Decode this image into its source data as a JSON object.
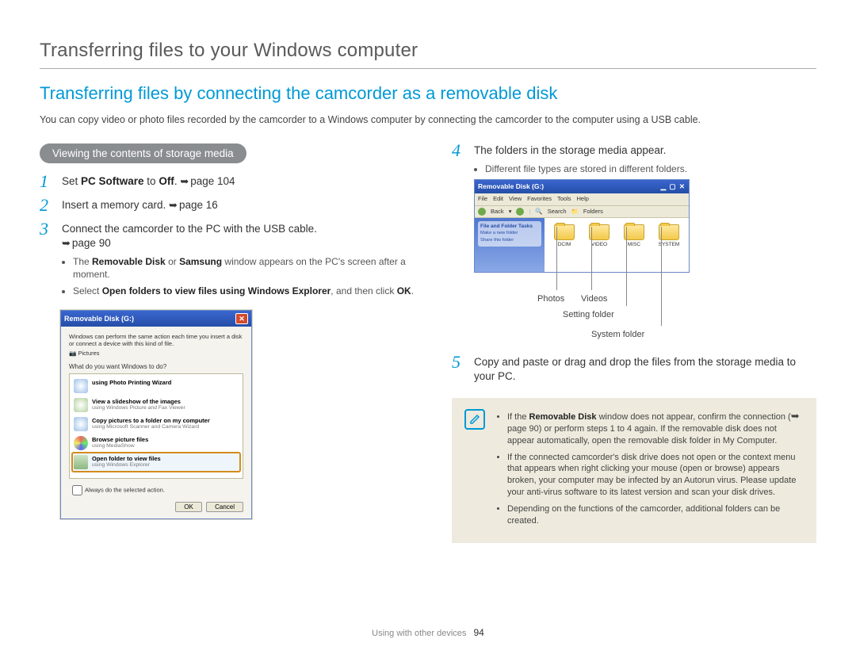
{
  "page_title": "Transferring files to your Windows computer",
  "section_heading": "Transferring files by connecting the camcorder as a removable disk",
  "intro": "You can copy video or photo files recorded by the camcorder to a Windows computer by connecting the camcorder to the computer using a USB cable.",
  "pill": "Viewing the contents of storage media",
  "arrow_glyph": "➥",
  "steps": {
    "s1": {
      "num": "1",
      "pre": "Set ",
      "bold": "PC Software",
      "mid": " to ",
      "bold2": "Off",
      "post": ". ",
      "page": "page 104"
    },
    "s2": {
      "num": "2",
      "text": "Insert a memory card. ",
      "page": "page 16"
    },
    "s3": {
      "num": "3",
      "text": "Connect the camcorder to the PC with the USB cable. ",
      "page": "page 90",
      "b1_pre": "The ",
      "b1_b1": "Removable Disk",
      "b1_mid": " or ",
      "b1_b2": "Samsung",
      "b1_post": " window appears on the PC's screen after a moment.",
      "b2_pre": "Select ",
      "b2_b": "Open folders to view files using Windows Explorer",
      "b2_mid": ", and then click ",
      "b2_b2": "OK",
      "b2_post": "."
    },
    "s4": {
      "num": "4",
      "text": "The folders in the storage media appear.",
      "b1": "Different file types are stored in different folders."
    },
    "s5": {
      "num": "5",
      "text": "Copy and paste or drag and drop the files from the storage media to your PC."
    }
  },
  "dialog": {
    "title": "Removable Disk (G:)",
    "hint": "Windows can perform the same action each time you insert a disk or connect a device with this kind of file.",
    "pictures": "Pictures",
    "question": "What do you want Windows to do?",
    "items": [
      {
        "b": "using Photo Printing Wizard",
        "s": ""
      },
      {
        "b": "View a slideshow of the images",
        "s": "using Windows Picture and Fax Viewer"
      },
      {
        "b": "Copy pictures to a folder on my computer",
        "s": "using Microsoft Scanner and Camera Wizard"
      },
      {
        "b": "Browse picture files",
        "s": "using MediaShow"
      },
      {
        "b": "Open folder to view files",
        "s": "using Windows Explorer"
      }
    ],
    "always": "Always do the selected action.",
    "ok": "OK",
    "cancel": "Cancel"
  },
  "explorer": {
    "title": "Removable Disk (G:)",
    "menu": [
      "File",
      "Edit",
      "View",
      "Favorites",
      "Tools",
      "Help"
    ],
    "toolbar": {
      "back": "Back",
      "search": "Search",
      "folders": "Folders"
    },
    "side": {
      "heading": "File and Folder Tasks",
      "i1": "Make a new folder",
      "i2": "Share this folder",
      "i3": ""
    },
    "folders": [
      "DCIM",
      "VIDEO",
      "MISC",
      "SYSTEM"
    ]
  },
  "callouts": {
    "photos": "Photos",
    "videos": "Videos",
    "setting": "Setting folder",
    "system": "System folder"
  },
  "note": {
    "n1_pre": "If the ",
    "n1_b": "Removable Disk",
    "n1_post": " window does not appear, confirm the connection (",
    "n1_page": "page 90",
    "n1_end": ") or perform steps 1 to 4 again. If the removable disk does not appear automatically, open the removable disk folder in My Computer.",
    "n2": "If the connected camcorder's disk drive does not open or the context menu that appears when right clicking your mouse (open or browse) appears broken, your computer may be infected by an Autorun virus. Please update your anti-virus software to its latest version and scan your disk drives.",
    "n3": "Depending on the functions of the camcorder, additional folders can be created."
  },
  "footer": {
    "section": "Using with other devices",
    "page": "94"
  }
}
